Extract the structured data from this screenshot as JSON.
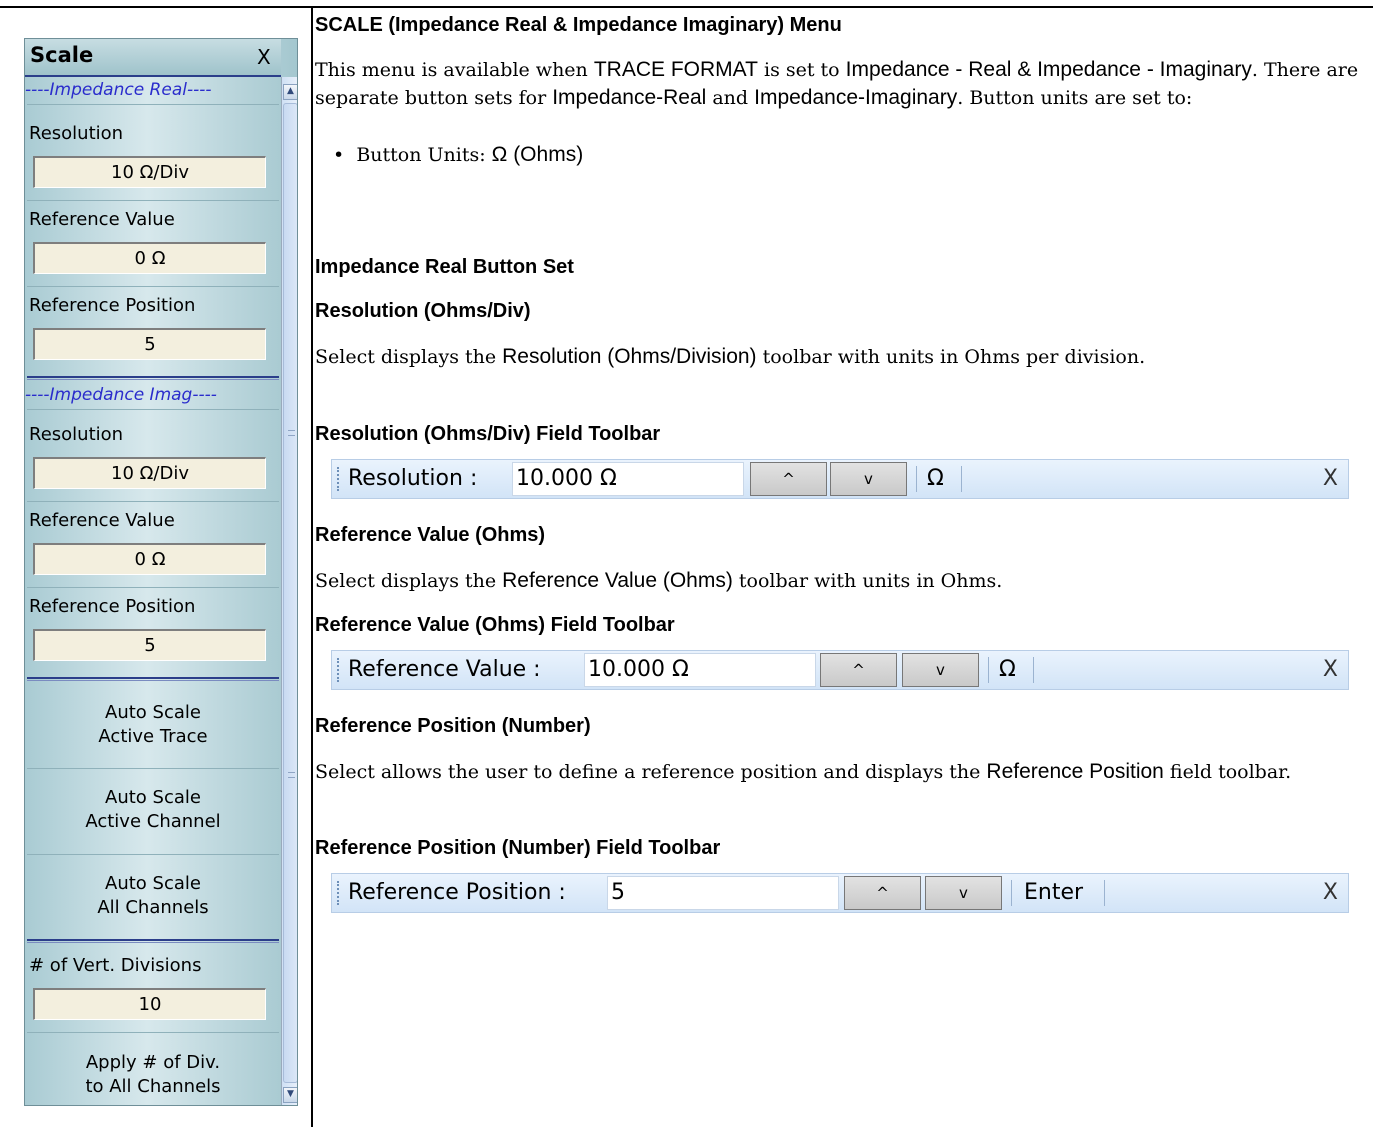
{
  "menu": {
    "title": "Scale",
    "close": "X",
    "real_section": "----Impedance Real----",
    "imag_section": "----Impedance Imag----",
    "real": {
      "resolution_label": "Resolution",
      "resolution_value": "10 Ω/Div",
      "ref_value_label": "Reference Value",
      "ref_value_value": "0 Ω",
      "ref_position_label": "Reference Position",
      "ref_position_value": "5"
    },
    "imag": {
      "resolution_label": "Resolution",
      "resolution_value": "10 Ω/Div",
      "ref_value_label": "Reference Value",
      "ref_value_value": "0 Ω",
      "ref_position_label": "Reference Position",
      "ref_position_value": "5"
    },
    "auto_trace": [
      "Auto Scale",
      "Active Trace"
    ],
    "auto_channel": [
      "Auto Scale",
      "Active Channel"
    ],
    "auto_all": [
      "Auto Scale",
      "All Channels"
    ],
    "vert_div_label": "# of Vert. Divisions",
    "vert_div_value": "10",
    "apply_div": [
      "Apply # of Div.",
      "to All Channels"
    ]
  },
  "doc": {
    "title": "SCALE (Impedance Real & Impedance Imaginary) Menu",
    "intro": {
      "t1": "This menu is available when ",
      "s1": "TRACE FORMAT",
      "t2": " is set to ",
      "s2": "Impedance - Real & Impedance - Imaginary",
      "t3": ". There are separate button sets for ",
      "s3": "Impedance-Real",
      "t4": " and ",
      "s4": "Impedance-Imaginary",
      "t5": ". Button units are set to:"
    },
    "bullet": {
      "mark": "•",
      "t1": "Button Units:  ",
      "s1": "Ω (Ohms)"
    },
    "real_set_heading": "Impedance Real Button Set",
    "resolution_heading": "Resolution (Ohms/Div)",
    "resolution_desc": {
      "t1": "Select displays the ",
      "s1": "Resolution (Ohms/Division)",
      "t2": " toolbar with units in Ohms per division."
    },
    "resolution_tb_heading": "Resolution (Ohms/Div) Field Toolbar",
    "ref_value_heading": "Reference Value (Ohms)",
    "ref_value_desc": {
      "t1": "Select displays the ",
      "s1": "Reference Value (Ohms)",
      "t2": " toolbar with units in Ohms."
    },
    "ref_value_tb_heading": "Reference Value (Ohms) Field Toolbar",
    "ref_pos_heading": "Reference Position (Number)",
    "ref_pos_desc": {
      "t1": "Select allows the user to define a reference position and displays the ",
      "s1": "Reference Position",
      "t2": " field toolbar."
    },
    "ref_pos_tb_heading": "Reference Position (Number) Field Toolbar"
  },
  "toolbars": {
    "resolution": {
      "label": "Resolution :",
      "value": "10.000  Ω",
      "unit": "Ω",
      "close": "X"
    },
    "ref_value": {
      "label": "Reference Value :",
      "value": "10.000  Ω",
      "unit": "Ω",
      "close": "X"
    },
    "ref_position": {
      "label": "Reference Position :",
      "value": "5",
      "unit": "Enter",
      "close": "X"
    },
    "up_arrow": "^",
    "down_arrow": "v"
  },
  "icons": {
    "up": "chevron-up-icon",
    "down": "chevron-down-icon",
    "close": "close-icon",
    "grip": "grip-icon"
  }
}
